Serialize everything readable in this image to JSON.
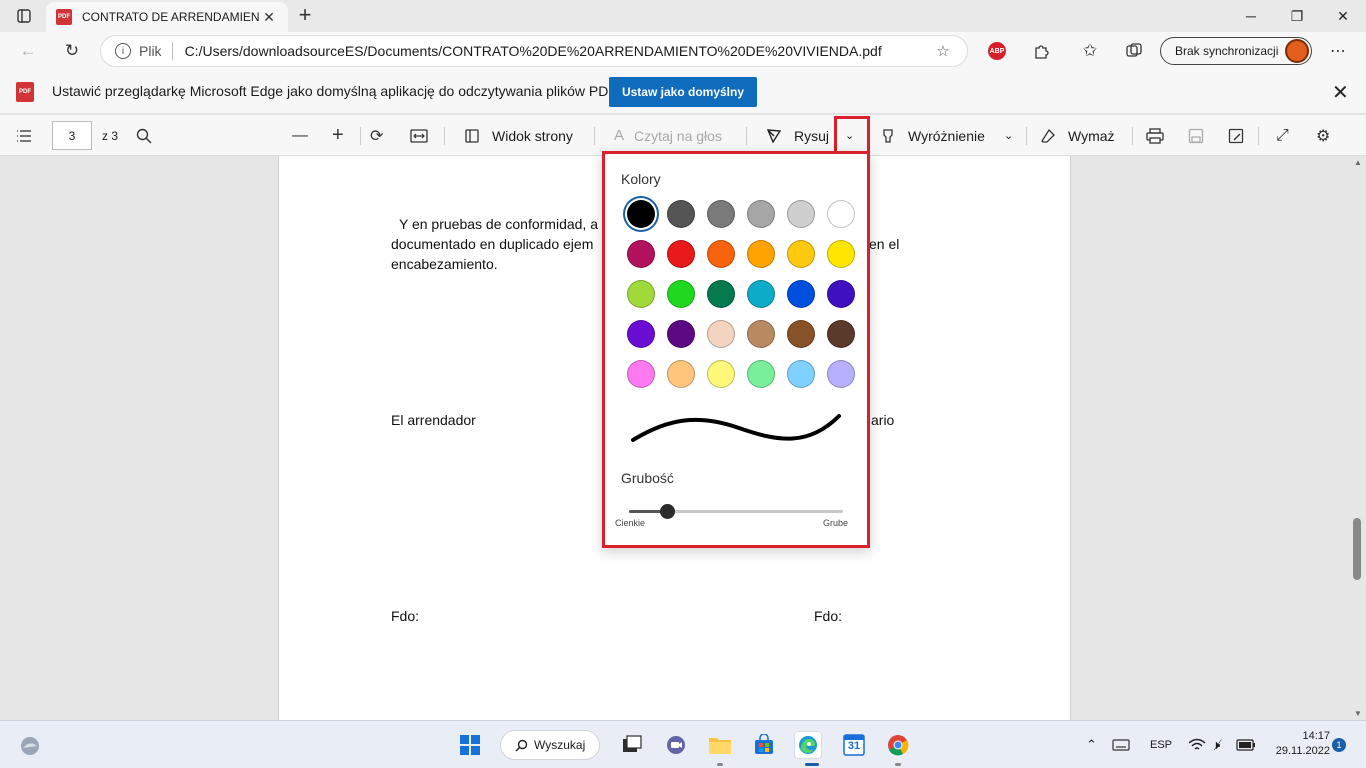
{
  "browser": {
    "tab_title": "CONTRATO DE ARRENDAMIENTO",
    "tab_icon": "PDF",
    "new_tab": "+",
    "address_scheme": "Plik",
    "url": "C:/Users/downloadsourceES/Documents/CONTRATO%20DE%20ARRENDAMIENTO%20DE%20VIVIENDA.pdf",
    "abp_label": "ABP",
    "sync_label": "Brak synchronizacji"
  },
  "infobar": {
    "message": "Ustawić przeglądarkę Microsoft Edge jako domyślną aplikację do odczytywania plików PDF?",
    "button": "Ustaw jako domyślny",
    "icon": "PDF"
  },
  "pdf_toolbar": {
    "page_current": "3",
    "page_total": "z 3",
    "page_view": "Widok strony",
    "read_aloud": "Czytaj na głos",
    "draw": "Rysuj",
    "highlight": "Wyróżnienie",
    "erase": "Wymaż"
  },
  "document": {
    "line1": "Y en pruebas de conformidad, a",
    "line2": "documentado en duplicado ejem",
    "line2_end": "en el",
    "line3": "encabezamiento.",
    "arrendador": "El arrendador",
    "arrendatario_fragment": "ario",
    "fdo_left": "Fdo:",
    "fdo_right": "Fdo:"
  },
  "draw_flyout": {
    "colors_label": "Kolory",
    "selected_color": "#000000",
    "colors": [
      "#000000",
      "#555555",
      "#7a7a7a",
      "#a6a6a6",
      "#cfcfcf",
      "#ffffff",
      "#b3125f",
      "#e81a1a",
      "#f7630c",
      "#ffa300",
      "#ffc90e",
      "#ffe600",
      "#9fd93a",
      "#20d820",
      "#057a4e",
      "#0eabc8",
      "#0050e0",
      "#3f10c0",
      "#6a0ed4",
      "#5c0a84",
      "#f3d4bf",
      "#b98a62",
      "#875228",
      "#5a3a2a",
      "#ff79f0",
      "#ffc57c",
      "#fff87a",
      "#79ef9a",
      "#7fd2ff",
      "#b7b0ff"
    ],
    "thickness_label": "Grubość",
    "thickness_value": 0.18,
    "thin_label": "Cienkie",
    "thick_label": "Grube"
  },
  "taskbar": {
    "search_label": "Wyszukaj",
    "language": "ESP",
    "time": "14:17",
    "date": "29.11.2022",
    "notifications": "1",
    "calendar_day": "31"
  }
}
